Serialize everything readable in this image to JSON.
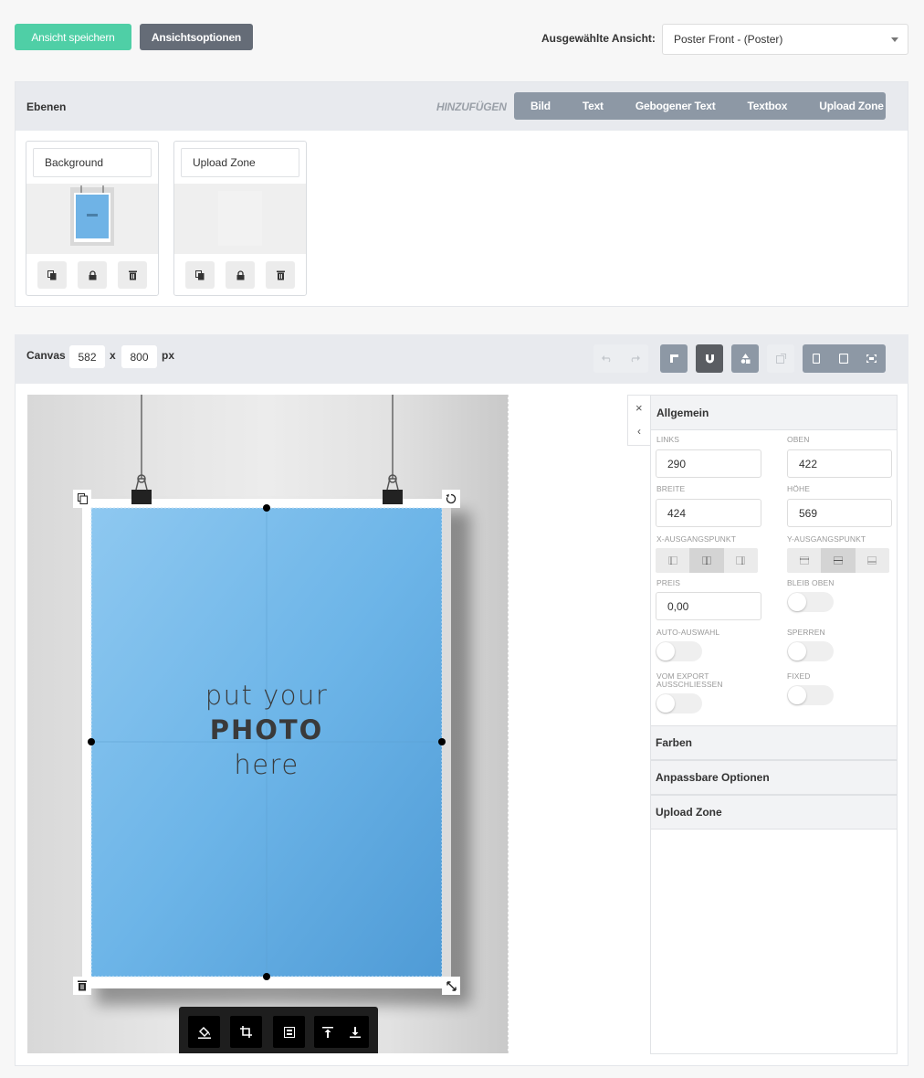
{
  "top": {
    "save_button": "Ansicht speichern",
    "options_button": "Ansichtsoptionen",
    "view_label": "Ausgewählte Ansicht:",
    "view_selected": "Poster Front - (Poster)"
  },
  "layers": {
    "title": "Ebenen",
    "add_label": "HINZUFÜGEN",
    "add_tabs": [
      "Bild",
      "Text",
      "Gebogener Text",
      "Textbox",
      "Upload Zone"
    ],
    "items": [
      {
        "name": "Background"
      },
      {
        "name": "Upload Zone"
      }
    ]
  },
  "canvas": {
    "label": "Canvas",
    "width": "582",
    "separator": "x",
    "height": "800",
    "unit": "px"
  },
  "poster": {
    "line1": "put your",
    "line2": "PHOTO",
    "line3": "here"
  },
  "properties": {
    "section_general": "Allgemein",
    "left_label": "LINKS",
    "left_value": "290",
    "top_label": "OBEN",
    "top_value": "422",
    "width_label": "BREITE",
    "width_value": "424",
    "height_label": "HÖHE",
    "height_value": "569",
    "x_origin_label": "X-AUSGANGSPUNKT",
    "y_origin_label": "Y-AUSGANGSPUNKT",
    "price_label": "PREIS",
    "price_value": "0,00",
    "stay_on_top_label": "BLEIB OBEN",
    "auto_select_label": "AUTO-AUSWAHL",
    "lock_label": "SPERREN",
    "exclude_export_label": "VOM EXPORT AUSSCHLIESSEN",
    "fixed_label": "FIXED",
    "section_colors": "Farben",
    "section_custom": "Anpassbare Optionen",
    "section_upload": "Upload Zone"
  },
  "colors": {
    "accent": "#4fcfa6",
    "dark_button": "#656c77",
    "tab_bar": "#8d98a5",
    "poster_blue": "#6fb3e6"
  }
}
